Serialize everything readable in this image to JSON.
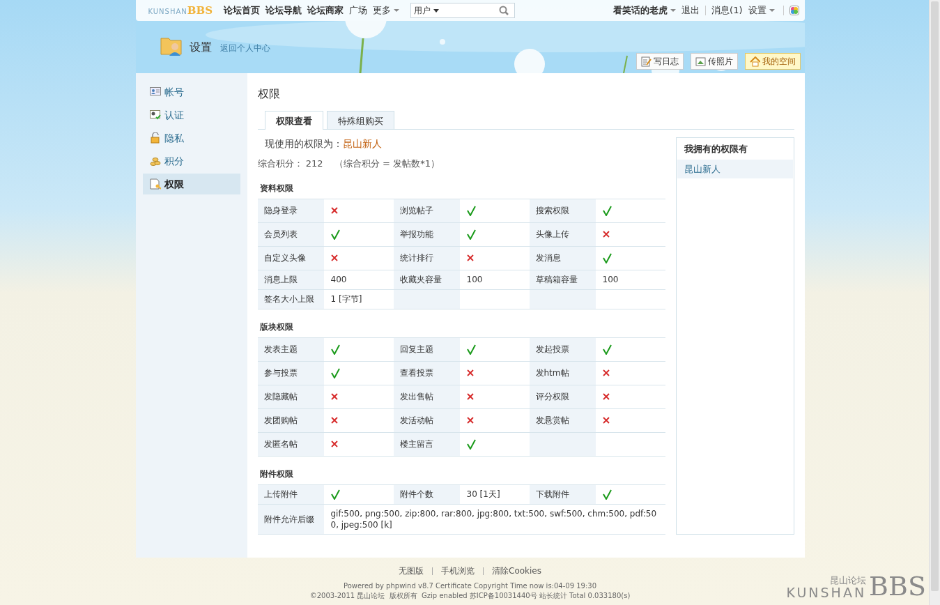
{
  "topbar": {
    "logo": {
      "small": "KUNSHAN",
      "big": "BBS"
    },
    "nav": [
      {
        "label": "论坛首页",
        "bold": true,
        "dropdown": false
      },
      {
        "label": "论坛导航",
        "bold": true,
        "dropdown": false
      },
      {
        "label": "论坛商家",
        "bold": true,
        "dropdown": false
      },
      {
        "label": "广场",
        "bold": false,
        "dropdown": false
      },
      {
        "label": "更多",
        "bold": false,
        "dropdown": true
      }
    ],
    "search": {
      "scope": "用户"
    },
    "user_links": [
      {
        "label": "看笑话的老虎",
        "bold": true,
        "dropdown": true
      },
      {
        "label": "退出",
        "bold": false,
        "dropdown": false
      },
      {
        "label": "消息(1)",
        "bold": false,
        "dropdown": false
      },
      {
        "label": "设置",
        "bold": false,
        "dropdown": true
      }
    ]
  },
  "header": {
    "title": "设置",
    "back_link": "返回个人中心",
    "buttons": [
      {
        "label": "写日志",
        "selected": false
      },
      {
        "label": "传照片",
        "selected": false
      },
      {
        "label": "我的空间",
        "selected": true
      }
    ]
  },
  "sidebar": {
    "items": [
      {
        "label": "帐号",
        "selected": false
      },
      {
        "label": "认证",
        "selected": false
      },
      {
        "label": "隐私",
        "selected": false
      },
      {
        "label": "积分",
        "selected": false
      },
      {
        "label": "权限",
        "selected": true
      }
    ]
  },
  "content": {
    "title": "权限",
    "tabs": [
      {
        "label": "权限查看",
        "selected": true
      },
      {
        "label": "特殊组购买",
        "selected": false
      }
    ],
    "current_group": {
      "label": "现使用的权限为：",
      "value": "昆山新人"
    },
    "points": {
      "label": "综合积分：",
      "value": "212",
      "formula": "（综合积分 = 发帖数*1）"
    },
    "sections": [
      {
        "title": "资料权限",
        "rows": [
          [
            {
              "label": "隐身登录",
              "kind": "flag",
              "allowed": false
            },
            {
              "label": "浏览帖子",
              "kind": "flag",
              "allowed": true
            },
            {
              "label": "搜索权限",
              "kind": "flag",
              "allowed": true
            }
          ],
          [
            {
              "label": "会员列表",
              "kind": "flag",
              "allowed": true
            },
            {
              "label": "举报功能",
              "kind": "flag",
              "allowed": true
            },
            {
              "label": "头像上传",
              "kind": "flag",
              "allowed": false
            }
          ],
          [
            {
              "label": "自定义头像",
              "kind": "flag",
              "allowed": false
            },
            {
              "label": "统计排行",
              "kind": "flag",
              "allowed": false
            },
            {
              "label": "发消息",
              "kind": "flag",
              "allowed": true
            }
          ],
          [
            {
              "label": "消息上限",
              "kind": "text",
              "value": "400"
            },
            {
              "label": "收藏夹容量",
              "kind": "text",
              "value": "100"
            },
            {
              "label": "草稿箱容量",
              "kind": "text",
              "value": "100"
            }
          ],
          [
            {
              "label": "签名大小上限",
              "kind": "text",
              "value": "1 [字节]"
            }
          ]
        ]
      },
      {
        "title": "版块权限",
        "rows": [
          [
            {
              "label": "发表主题",
              "kind": "flag",
              "allowed": true
            },
            {
              "label": "回复主题",
              "kind": "flag",
              "allowed": true
            },
            {
              "label": "发起投票",
              "kind": "flag",
              "allowed": true
            }
          ],
          [
            {
              "label": "参与投票",
              "kind": "flag",
              "allowed": true
            },
            {
              "label": "查看投票",
              "kind": "flag",
              "allowed": false
            },
            {
              "label": "发htm帖",
              "kind": "flag",
              "allowed": false
            }
          ],
          [
            {
              "label": "发隐藏帖",
              "kind": "flag",
              "allowed": false
            },
            {
              "label": "发出售帖",
              "kind": "flag",
              "allowed": false
            },
            {
              "label": "评分权限",
              "kind": "flag",
              "allowed": false
            }
          ],
          [
            {
              "label": "发团购帖",
              "kind": "flag",
              "allowed": false
            },
            {
              "label": "发活动帖",
              "kind": "flag",
              "allowed": false
            },
            {
              "label": "发悬赏帖",
              "kind": "flag",
              "allowed": false
            }
          ],
          [
            {
              "label": "发匿名帖",
              "kind": "flag",
              "allowed": false
            },
            {
              "label": "楼主留言",
              "kind": "flag",
              "allowed": true
            }
          ]
        ]
      },
      {
        "title": "附件权限",
        "rows": [
          [
            {
              "label": "上传附件",
              "kind": "flag",
              "allowed": true
            },
            {
              "label": "附件个数",
              "kind": "text",
              "value": "30 [1天]"
            },
            {
              "label": "下载附件",
              "kind": "flag",
              "allowed": true
            }
          ],
          [
            {
              "label": "附件允许后缀",
              "kind": "wide",
              "value": "gif:500, png:500, zip:800, rar:800, jpg:800, txt:500, swf:500, chm:500, pdf:500, jpeg:500 [k]"
            }
          ]
        ]
      }
    ],
    "owned": {
      "title": "我拥有的权限有",
      "items": [
        "昆山新人"
      ]
    }
  },
  "footer": {
    "links": [
      "无图版",
      "手机浏览",
      "清除Cookies"
    ],
    "powered": {
      "before": "Powered by",
      "link": "phpwind v8.7",
      "after": "Certificate Copyright Time now is:04-09 19:30"
    },
    "copyright": "©2003-2011 昆山论坛  版权所有  Gzip enabled 苏ICP备10031440号 站长统计 Total 0.033180(s)",
    "corner_logo": {
      "cn": "昆山论坛",
      "en": "KUNSHAN",
      "big": "BBS"
    }
  }
}
